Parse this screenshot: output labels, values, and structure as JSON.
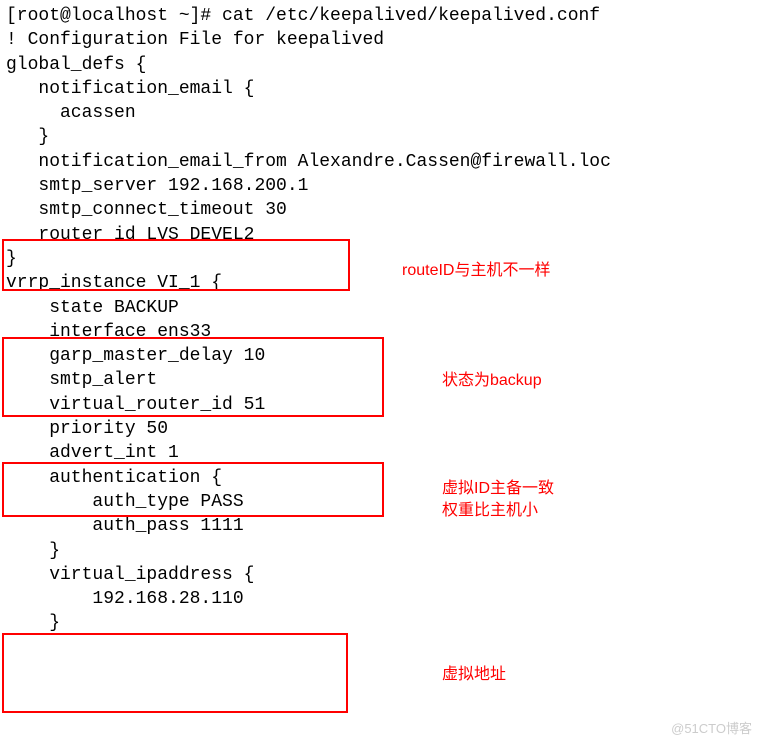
{
  "lines": {
    "l1": "[root@localhost ~]# cat /etc/keepalived/keepalived.conf",
    "l2": "! Configuration File for keepalived",
    "l3": "",
    "l4": "global_defs {",
    "l5": "   notification_email {",
    "l6": "     acassen",
    "l7": "   }",
    "l8": "   notification_email_from Alexandre.Cassen@firewall.loc",
    "l9": "   smtp_server 192.168.200.1",
    "l10": "   smtp_connect_timeout 30",
    "l11": "   router_id LVS_DEVEL2",
    "l12": "}",
    "l13": "",
    "l14": "",
    "l15": "vrrp_instance VI_1 {",
    "l16": "    state BACKUP",
    "l17": "    interface ens33",
    "l18": "    garp_master_delay 10",
    "l19": "    smtp_alert",
    "l20": "    virtual_router_id 51",
    "l21": "    priority 50",
    "l22": "    advert_int 1",
    "l23": "    authentication {",
    "l24": "        auth_type PASS",
    "l25": "        auth_pass 1111",
    "l26": "    }",
    "l27": "    virtual_ipaddress {",
    "l28": "        192.168.28.110",
    "l29": "    }"
  },
  "annotations": {
    "a1": "routeID与主机不一样",
    "a2": "状态为backup",
    "a3": "虚拟ID主备一致",
    "a4": "权重比主机小",
    "a5": "虚拟地址"
  },
  "watermark": "@51CTO博客"
}
